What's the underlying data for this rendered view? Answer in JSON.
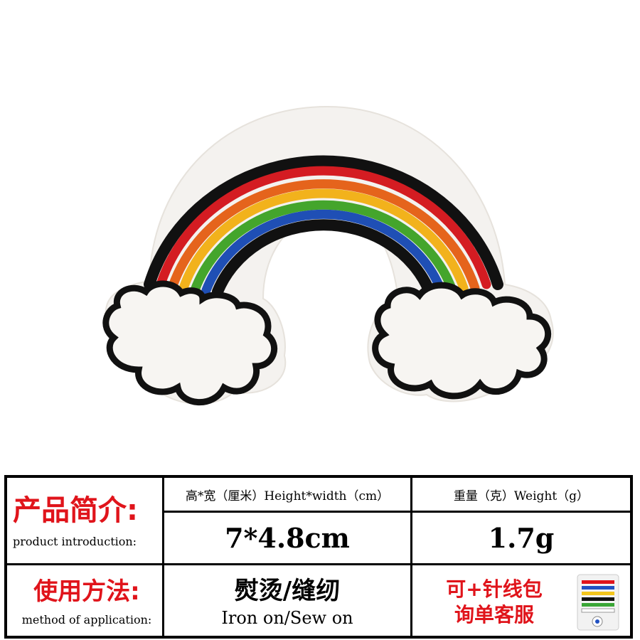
{
  "product_image": {
    "description_icon": "rainbow-cloud-patch"
  },
  "table": {
    "intro_label_cn": "产品简介:",
    "intro_label_en": "product introduction:",
    "size_header": "高*宽（厘米）Height*width（cm）",
    "weight_header": "重量（克）Weight（g）",
    "size_value": "7*4.8cm",
    "weight_value": "1.7g",
    "method_label_cn": "使用方法:",
    "method_label_en": "method of application:",
    "method_value_cn": "熨烫/缝纫",
    "method_value_en": "Iron on/Sew on",
    "extra_line1": "可+针线包",
    "extra_line2": "询单客服",
    "sewing_kit_icon": "sewing-kit-icon"
  },
  "colors": {
    "accent_red": "#e0141b",
    "border": "#000000"
  }
}
